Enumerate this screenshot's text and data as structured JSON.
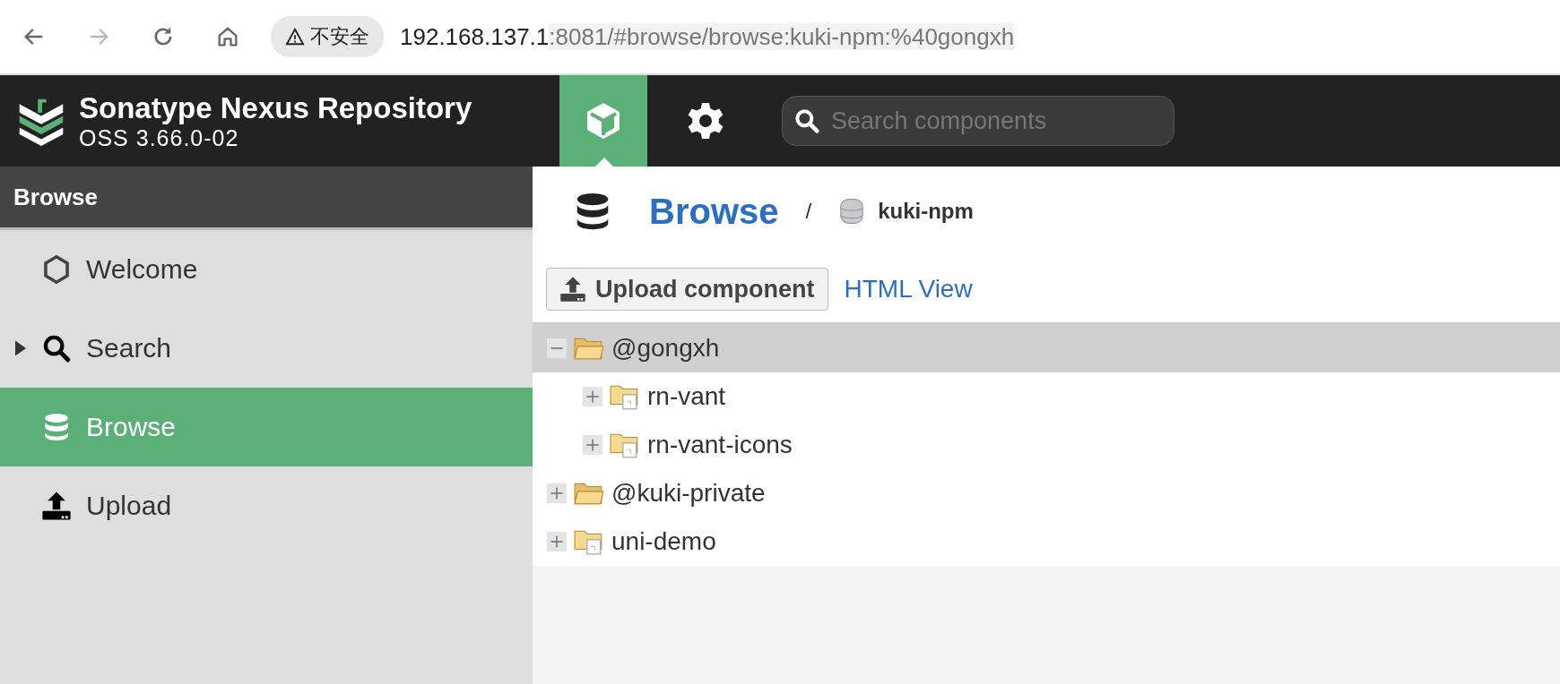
{
  "browser": {
    "security_label": "不安全",
    "url_host": "192.168.137.1",
    "url_rest": ":8081/#browse/browse:kuki-npm:%40gongxh"
  },
  "header": {
    "product": "Sonatype Nexus Repository",
    "version": "OSS 3.66.0-02",
    "modes": [
      {
        "kind": "browse",
        "selected": true
      },
      {
        "kind": "admin",
        "selected": false
      }
    ],
    "search": {
      "placeholder": "Search components"
    }
  },
  "sidebar": {
    "title": "Browse",
    "items": [
      {
        "label": "Welcome",
        "kind": "welcome",
        "selected": false
      },
      {
        "label": "Search",
        "kind": "search",
        "selected": false,
        "expanded": false
      },
      {
        "label": "Browse",
        "kind": "browse",
        "selected": true
      },
      {
        "label": "Upload",
        "kind": "upload",
        "selected": false
      }
    ]
  },
  "breadcrumb": {
    "title": "Browse",
    "separator": "/",
    "repository": "kuki-npm"
  },
  "toolbar": {
    "upload_button": "Upload component",
    "html_link": "HTML View"
  },
  "tree": [
    {
      "label": "@gongxh",
      "kind": "folder",
      "expanded": true,
      "selected": true,
      "children": [
        {
          "label": "rn-vant",
          "kind": "package",
          "expanded": false,
          "selected": false
        },
        {
          "label": "rn-vant-icons",
          "kind": "package",
          "expanded": false,
          "selected": false
        }
      ]
    },
    {
      "label": "@kuki-private",
      "kind": "folder",
      "expanded": false,
      "selected": false
    },
    {
      "label": "uni-demo",
      "kind": "package",
      "expanded": false,
      "selected": false
    }
  ]
}
